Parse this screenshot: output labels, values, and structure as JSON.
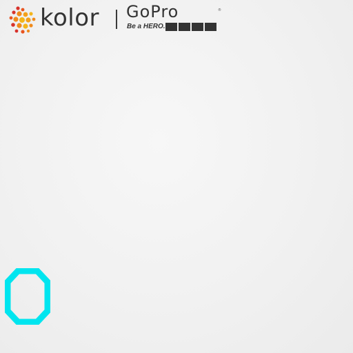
{
  "brand": {
    "kolor_name": "kolor",
    "gopro_name": "GoPro",
    "gopro_registered": "®",
    "gopro_tagline": "Be a HERO.",
    "colors": {
      "kolor_orange": "#f08a1c",
      "kolor_red": "#d7322b",
      "kolor_yellow": "#f3b51b",
      "wordmark": "#333333"
    }
  },
  "overlay": {
    "digit": "0",
    "color": "#00e5ef"
  },
  "background": {
    "color": "#f2f2f2"
  }
}
